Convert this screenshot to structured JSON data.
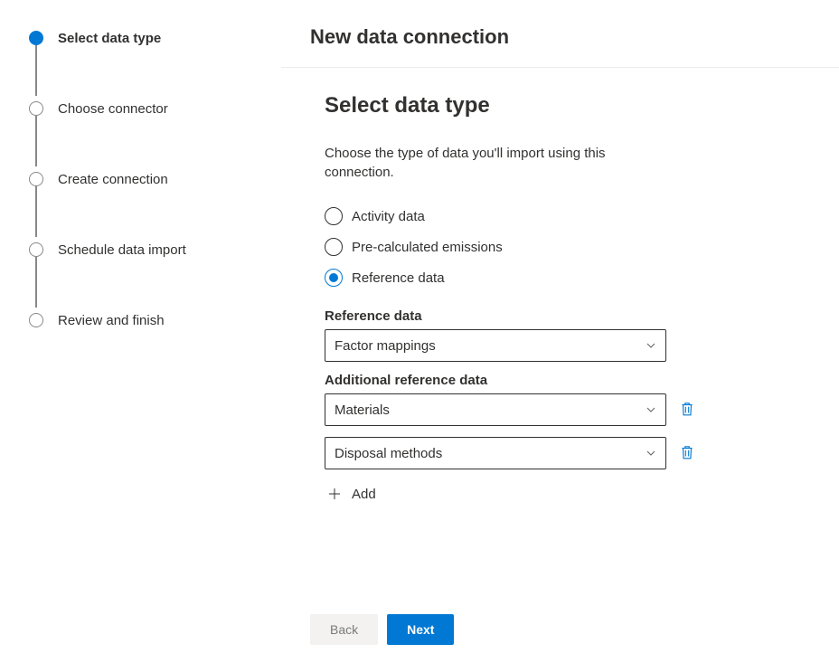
{
  "page_title": "New data connection",
  "stepper": {
    "steps": [
      {
        "label": "Select data type",
        "active": true
      },
      {
        "label": "Choose connector",
        "active": false
      },
      {
        "label": "Create connection",
        "active": false
      },
      {
        "label": "Schedule data import",
        "active": false
      },
      {
        "label": "Review and finish",
        "active": false
      }
    ]
  },
  "section": {
    "title": "Select data type",
    "description": "Choose the type of data you'll import using this connection."
  },
  "radio": {
    "options": [
      {
        "label": "Activity data",
        "selected": false
      },
      {
        "label": "Pre-calculated emissions",
        "selected": false
      },
      {
        "label": "Reference data",
        "selected": true
      }
    ]
  },
  "reference": {
    "label": "Reference data",
    "value": "Factor mappings"
  },
  "additional": {
    "label": "Additional reference data",
    "items": [
      {
        "value": "Materials"
      },
      {
        "value": "Disposal methods"
      }
    ],
    "add_label": "Add"
  },
  "footer": {
    "back": "Back",
    "next": "Next"
  },
  "colors": {
    "primary": "#0078d4"
  }
}
